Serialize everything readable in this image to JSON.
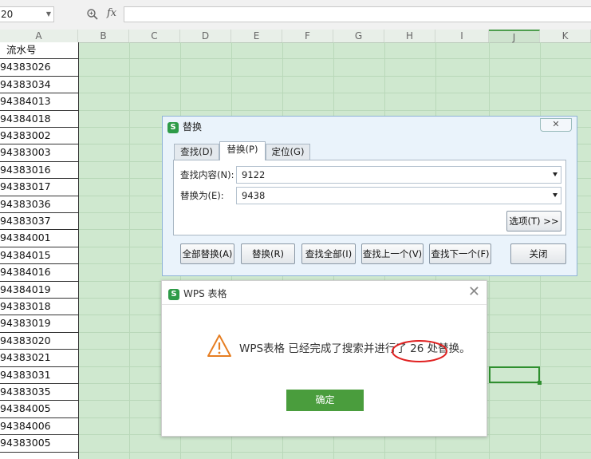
{
  "formula_bar": {
    "name_box": "20",
    "fx_label": "fx"
  },
  "columns": [
    "A",
    "B",
    "C",
    "D",
    "E",
    "F",
    "G",
    "H",
    "I",
    "J",
    "K"
  ],
  "column_a_values": [
    "流水号",
    "94383026",
    "94383034",
    "94384013",
    "94384018",
    "94383002",
    "94383003",
    "94383016",
    "94383017",
    "94383036",
    "94383037",
    "94384001",
    "94384015",
    "94384016",
    "94384019",
    "94383018",
    "94383019",
    "94383020",
    "94383021",
    "94383031",
    "94383035",
    "94384005",
    "94384006",
    "94383005"
  ],
  "replace_dialog": {
    "title": "替换",
    "tabs": [
      "查找(D)",
      "替换(P)",
      "定位(G)"
    ],
    "find_label": "查找内容(N):",
    "find_value": "9122",
    "replace_label": "替换为(E):",
    "replace_value": "9438",
    "options_button": "选项(T) >>",
    "buttons": [
      "全部替换(A)",
      "替换(R)",
      "查找全部(I)",
      "查找上一个(V)",
      "查找下一个(F)",
      "关闭"
    ]
  },
  "message_dialog": {
    "title": "WPS 表格",
    "message_prefix": "WPS表格 已经完成了搜索并进行了",
    "message_highlight": "26 处替换。",
    "ok_button": "确定"
  },
  "colors": {
    "sheet_bg": "#cfe8cf",
    "ok_button": "#4a9d3d",
    "highlight_ellipse": "#e02020",
    "warning": "#e67e22"
  }
}
